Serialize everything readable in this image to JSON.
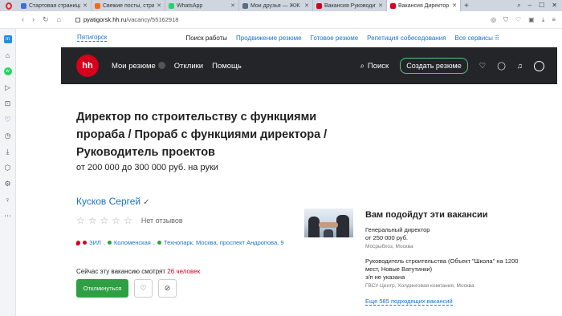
{
  "browser": {
    "tabs": [
      {
        "label": "Стартовая страница - О",
        "color": "#3b6fd6"
      },
      {
        "label": "Свежие посты, страни...",
        "color": "#f26a1b"
      },
      {
        "label": "WhatsApp",
        "color": "#25d366"
      },
      {
        "label": "Мои друзья — ЖЖ",
        "color": "#5b6b82"
      },
      {
        "label": "Вакансия Руководител...",
        "color": "#d6001c"
      },
      {
        "label": "Вакансия Директор по",
        "color": "#d6001c"
      }
    ],
    "url_domain": "pyatigorsk.hh.ru",
    "url_path": "/vacancy/55162918"
  },
  "top": {
    "city": "Пятигорск",
    "links": [
      "Поиск работы",
      "Продвижение резюме",
      "Готовое резюме",
      "Репетиция собеседования",
      "Все сервисы"
    ]
  },
  "header": {
    "logo": "hh",
    "nav": [
      "Мои резюме",
      "Отклики",
      "Помощь"
    ],
    "search": "Поиск",
    "create": "Создать резюме"
  },
  "vacancy": {
    "title": "Директор по строительству с функциями прораба / Прораб с функциями директора / Руководитель проектов",
    "salary": "от 200 000 до 300 000 руб. на руки",
    "company": "Кусков Сергей",
    "reviews": "Нет отзывов",
    "address": {
      "metro": [
        {
          "name": "ЗИЛ",
          "color": "#d6001c"
        },
        {
          "name": "Коломенская",
          "color": "#2ea043"
        },
        {
          "name": "Технопарк",
          "color": "#2ea043"
        }
      ],
      "street": ", Москва, проспект Андропова, 9"
    },
    "watching_prefix": "Сейчас эту вакансию смотрят",
    "watching_count": "26 человек",
    "apply": "Откликнуться"
  },
  "suggest": {
    "title": "Вам подойдут эти вакансии",
    "jobs": [
      {
        "name": "Генеральный директор",
        "salary": "от 250 000 руб.",
        "company": "Мосрыбхоз, Москва"
      },
      {
        "name": "Руководитель строительства (Объект \"Школа\" на 1200 мест, Новые Ватутинки)",
        "salary": "з/п не указана",
        "company": "ГВСУ Центр, Холдинговая компания, Москва"
      }
    ],
    "more": "Еще 585 подходящих вакансий"
  }
}
